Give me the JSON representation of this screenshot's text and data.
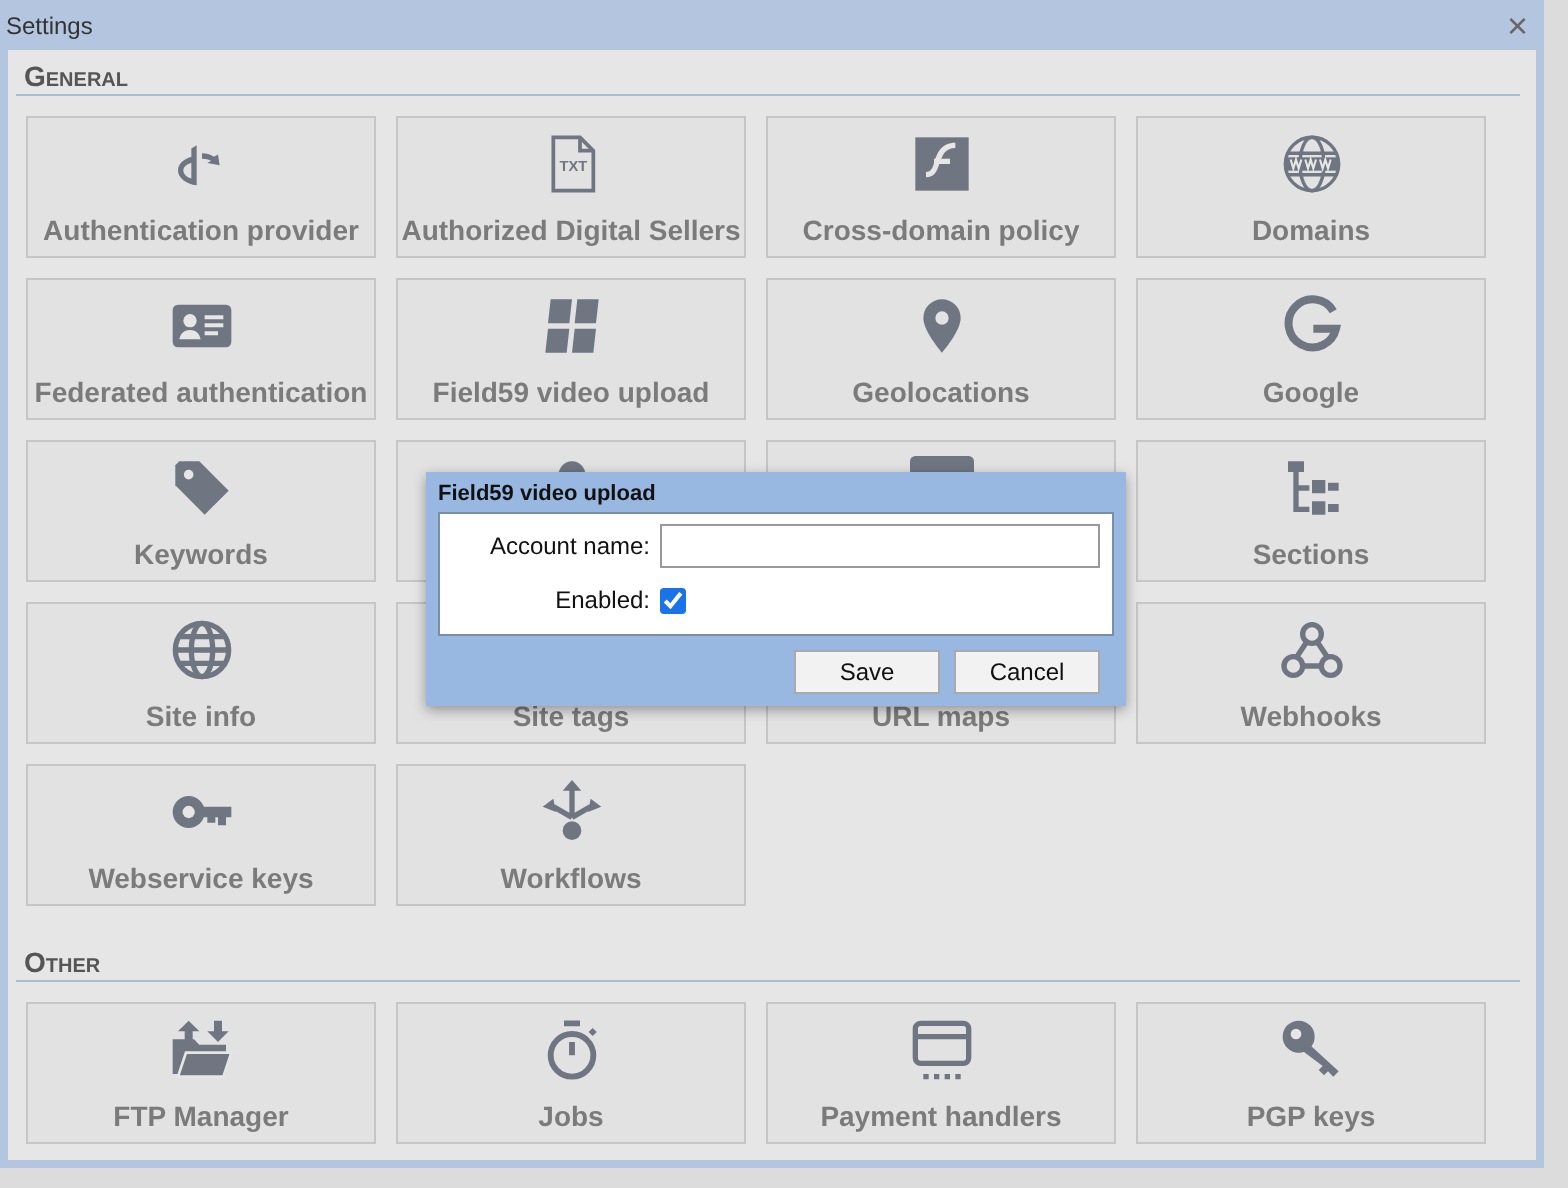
{
  "window": {
    "title": "Settings",
    "close": "×"
  },
  "sections": [
    {
      "title": "General",
      "tiles": [
        {
          "label": "Authentication provider"
        },
        {
          "label": "Authorized Digital Sellers",
          "icon_text": "TXT"
        },
        {
          "label": "Cross-domain policy"
        },
        {
          "label": "Domains"
        },
        {
          "label": "Federated authentication"
        },
        {
          "label": "Field59 video upload"
        },
        {
          "label": "Geolocations"
        },
        {
          "label": "Google"
        },
        {
          "label": "Keywords"
        },
        {
          "label": "Sections"
        },
        {
          "label": "Site info"
        },
        {
          "label": "Site tags"
        },
        {
          "label": "URL maps"
        },
        {
          "label": "Webhooks"
        },
        {
          "label": "Webservice keys"
        },
        {
          "label": "Workflows"
        }
      ]
    },
    {
      "title": "Other",
      "tiles": [
        {
          "label": "FTP Manager"
        },
        {
          "label": "Jobs"
        },
        {
          "label": "Payment handlers"
        },
        {
          "label": "PGP keys"
        }
      ]
    }
  ],
  "dialog": {
    "title": "Field59 video upload",
    "fields": [
      {
        "kind": "text",
        "label": "Account name:"
      },
      {
        "kind": "checkbox",
        "label": "Enabled:",
        "checked": true
      }
    ],
    "buttons": [
      "Save",
      "Cancel"
    ]
  }
}
